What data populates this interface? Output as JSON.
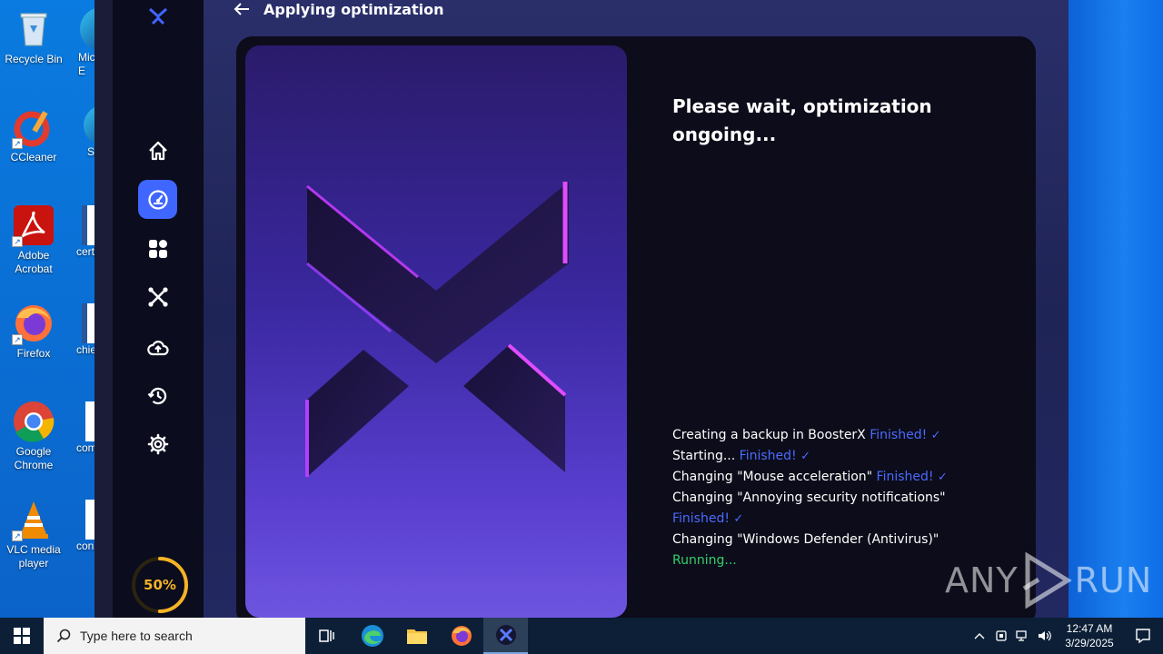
{
  "desktop": {
    "icons": [
      {
        "label": "Recycle Bin"
      },
      {
        "label": "CCleaner"
      },
      {
        "label": "Adobe Acrobat"
      },
      {
        "label": "Firefox"
      },
      {
        "label": "Google Chrome"
      },
      {
        "label": "VLC media player"
      }
    ],
    "partial_icons": [
      {
        "label": "Mic E"
      },
      {
        "label": "Sl"
      },
      {
        "label": "certi"
      },
      {
        "label": "chief"
      },
      {
        "label": "com"
      },
      {
        "label": "cons"
      }
    ]
  },
  "app": {
    "header_title": "Applying optimization",
    "sidebar": {
      "items": [
        {
          "icon": "home-icon"
        },
        {
          "icon": "speedometer-icon",
          "active": true
        },
        {
          "icon": "apps-grid-icon"
        },
        {
          "icon": "tools-icon"
        },
        {
          "icon": "cloud-upload-icon"
        },
        {
          "icon": "history-icon"
        },
        {
          "icon": "settings-icon"
        }
      ],
      "progress": {
        "label": "50%",
        "value": 0.5
      }
    },
    "panel_title": "Please wait, optimization ongoing...",
    "log": [
      {
        "text": "Creating a backup in BoosterX",
        "status": "Finished!",
        "state": "finished"
      },
      {
        "text": "Starting...",
        "status": "Finished!",
        "state": "finished"
      },
      {
        "text": "Changing \"Mouse acceleration\"",
        "status": "Finished!",
        "state": "finished"
      },
      {
        "text": "Changing \"Annoying security notifications\"",
        "status": "Finished!",
        "state": "finished"
      },
      {
        "text": "Changing \"Windows Defender (Antivirus)\"",
        "status": "Running...",
        "state": "running"
      }
    ],
    "colors": {
      "accent": "#3f66ff",
      "finished": "#4a6bff",
      "running": "#35d06a",
      "progress": "#f5b326"
    }
  },
  "watermark": {
    "left": "ANY",
    "right": "RUN"
  },
  "taskbar": {
    "search_placeholder": "Type here to search",
    "apps": [
      "task-view-icon",
      "edge-icon",
      "file-explorer-icon",
      "firefox-icon",
      "boosterx-icon"
    ],
    "clock_time": "12:47 AM",
    "clock_date": "3/29/2025"
  }
}
